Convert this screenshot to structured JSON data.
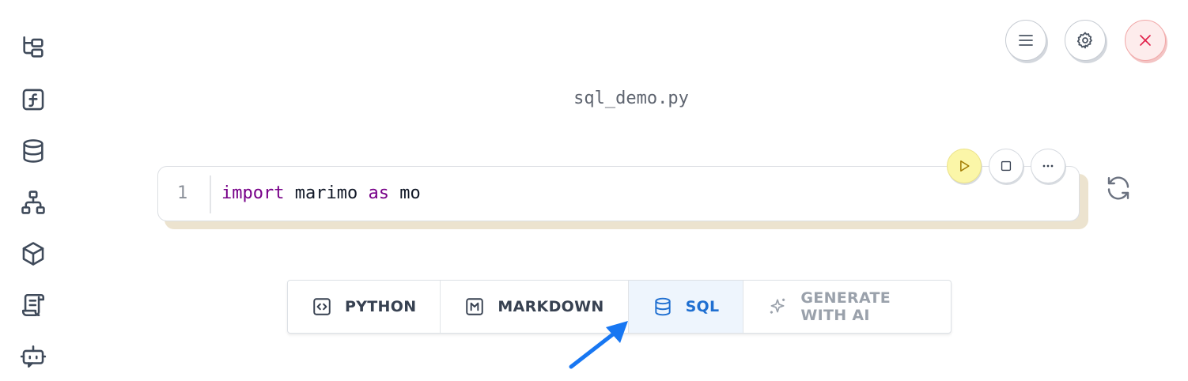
{
  "sidebar": {
    "items": [
      {
        "icon": "file-tree-icon"
      },
      {
        "icon": "function-icon"
      },
      {
        "icon": "database-icon"
      },
      {
        "icon": "dependency-graph-icon"
      },
      {
        "icon": "package-icon"
      },
      {
        "icon": "scroll-icon"
      },
      {
        "icon": "bot-icon"
      }
    ]
  },
  "header": {
    "filename": "sql_demo.py",
    "buttons": [
      "menu-icon",
      "gear-icon",
      "close-icon"
    ]
  },
  "cell": {
    "line_number": "1",
    "code": {
      "kw1": "import",
      "t1": " marimo ",
      "kw2": "as",
      "t2": " mo"
    }
  },
  "add_cell_toolbar": {
    "python_label": "PYTHON",
    "markdown_label": "MARKDOWN",
    "sql_label": "SQL",
    "ai_label": "GENERATE WITH AI"
  },
  "colors": {
    "sql_accent": "#1f6fd1",
    "run_button_bg": "#fbf6a8",
    "close_button_bg": "#fdecec",
    "arrow": "#1877f2"
  }
}
